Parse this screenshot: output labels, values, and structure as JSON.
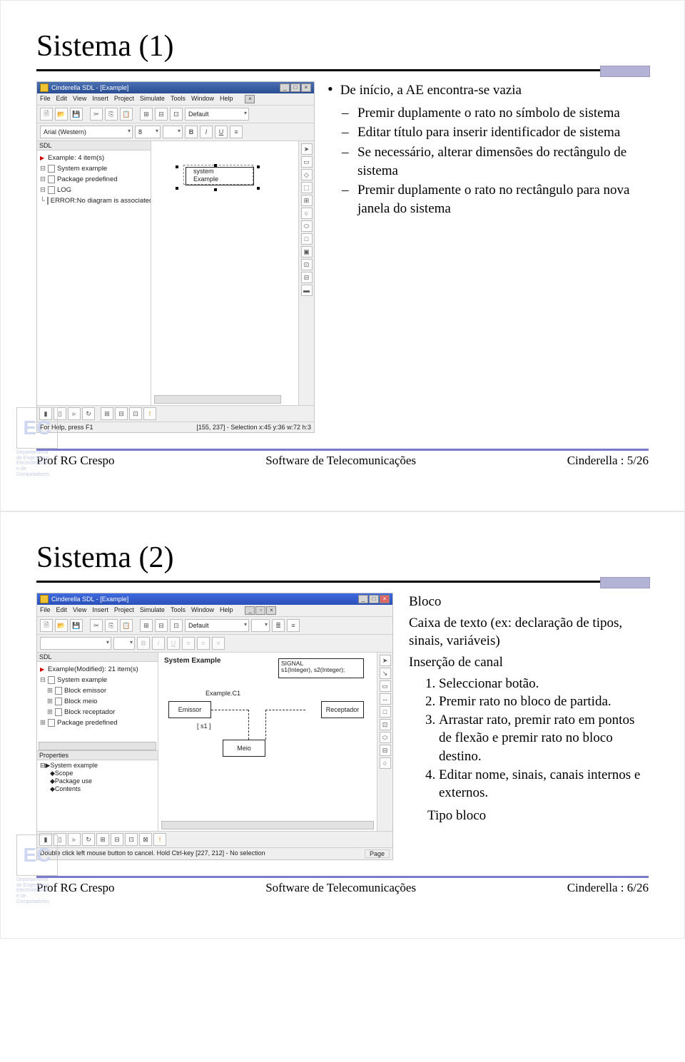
{
  "slide1": {
    "title": "Sistema (1)",
    "app_title": "Cinderella SDL - [Example]",
    "menus": [
      "File",
      "Edit",
      "View",
      "Insert",
      "Project",
      "Simulate",
      "Tools",
      "Window",
      "Help"
    ],
    "combo_layer": "Default",
    "font_combo": "Arial (Western)",
    "size_combo": "8",
    "tree_title": "SDL",
    "tree_root": "Example: 4 item(s)",
    "tree_items": [
      "System example",
      "Package predefined",
      "LOG",
      "ERROR:No diagram is associated"
    ],
    "canvas_label_top": "system",
    "canvas_label_bottom": "Example",
    "status_left": "For Help, press F1",
    "status_right": "[155, 237] - Selection x:45 y:36 w:72 h:3",
    "lead": "De início, a AE encontra-se vazia",
    "subs": [
      "Premir duplamente o rato no símbolo de sistema",
      "Editar título para inserir identificador de sistema",
      "Se necessário, alterar dimensões do rectângulo de sistema",
      "Premir duplamente o rato no rectângulo para nova janela do sistema"
    ]
  },
  "slide2": {
    "title": "Sistema (2)",
    "app_title": "Cinderella SDL - [Example]",
    "menus": [
      "File",
      "Edit",
      "View",
      "Insert",
      "Project",
      "Simulate",
      "Tools",
      "Window",
      "Help"
    ],
    "combo_layer": "Default",
    "tree_title": "SDL",
    "tree_root": "Example(Modified): 21 item(s)",
    "tree_items": [
      "System example",
      "Block emissor",
      "Block meio",
      "Block receptador",
      "Package predefined"
    ],
    "props_title": "Properties",
    "props_root": "System example",
    "props_items": [
      "Scope",
      "Package use",
      "Contents"
    ],
    "canvas_sys_label": "System  Example",
    "signal_line1": "SIGNAL",
    "signal_line2": "s1(Integer), s2(Integer);",
    "chan_name": "Example.C1",
    "blk_emissor": "Emissor",
    "blk_receptador": "Receptador",
    "blk_meio": "Meio",
    "sig_s1": "[ s1 ]",
    "status_left": "Double click left mouse button to cancel. Hold Ctrl-key  [227, 212] - No selection",
    "status_right_cell": "Page",
    "callout_bloco": "Bloco",
    "callout_caixa": "Caixa de texto (ex: declaração de tipos, sinais, variáveis)",
    "callout_insercao": "Inserção de canal",
    "steps": [
      "Seleccionar botão.",
      "Premir rato no bloco de partida.",
      "Arrastar rato, premir rato em pontos de flexão e premir rato no bloco destino.",
      "Editar nome, sinais, canais internos e externos."
    ],
    "callout_tipo": "Tipo bloco"
  },
  "footer": {
    "author": "Prof RG Crespo",
    "center": "Software de Telecomunicações",
    "right1": "Cinderella : 5/26",
    "right2": "Cinderella : 6/26"
  },
  "logo": {
    "text": "EC",
    "caption": "Departamento\nde Engenharia\nElectrotécnica\ne de\nComputadores"
  },
  "icons": {
    "arrow": "▶",
    "folder": "📁",
    "save": "💾"
  }
}
